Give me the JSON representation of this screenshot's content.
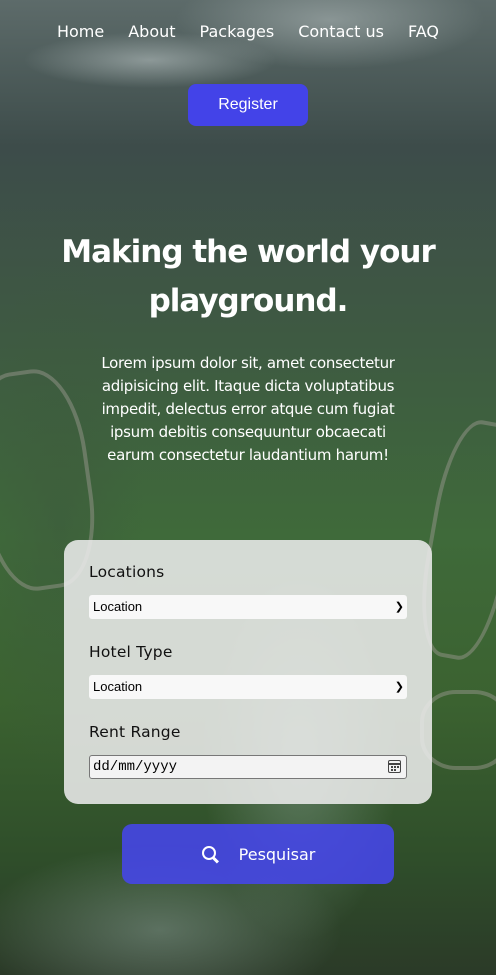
{
  "nav": {
    "items": [
      "Home",
      "About",
      "Packages",
      "Contact us",
      "FAQ"
    ]
  },
  "register_label": "Register",
  "hero": {
    "title": "Making the world your playground.",
    "description": "Lorem ipsum dolor sit, amet consectetur adipisicing elit. Itaque dicta voluptatibus impedit, delectus error atque cum fugiat ipsum debitis consequuntur obcaecati earum consectetur laudantium harum!"
  },
  "search_form": {
    "locations_label": "Locations",
    "locations_value": "Location",
    "hotel_type_label": "Hotel Type",
    "hotel_type_value": "Location",
    "rent_range_label": "Rent Range",
    "rent_range_placeholder": "dd/mm/yyyy",
    "submit_label": "Pesquisar"
  },
  "colors": {
    "accent": "#4343e8",
    "card_bg": "#ebebeb"
  },
  "icons": {
    "search": "search-icon",
    "calendar": "calendar-icon",
    "chevron": "chevron-down-icon"
  }
}
